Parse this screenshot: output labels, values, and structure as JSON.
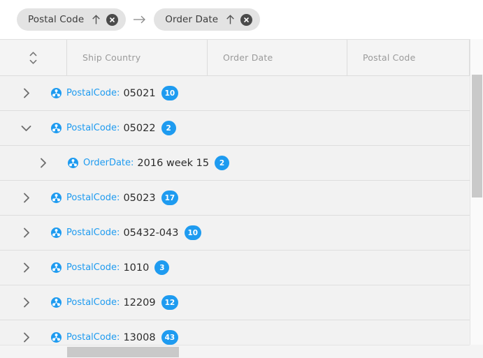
{
  "chip_bar": {
    "chips": [
      {
        "label": "Postal Code",
        "sort_icon": "arrow-up-icon",
        "close_icon": "close-circle-icon"
      },
      {
        "label": "Order Date",
        "sort_icon": "arrow-up-icon",
        "close_icon": "close-circle-icon"
      }
    ],
    "separator_icon": "arrow-right-icon"
  },
  "table": {
    "sort_toggle_icon": "sort-updown-icon",
    "columns": [
      {
        "label": ""
      },
      {
        "label": "Ship Country"
      },
      {
        "label": "Order Date"
      },
      {
        "label": "Postal Code"
      }
    ],
    "rows": [
      {
        "level": 0,
        "expanded": false,
        "twisty_icon": "chevron-right-icon",
        "group_icon": "group-node-icon",
        "field": "PostalCode:",
        "value": "05021",
        "count": "10"
      },
      {
        "level": 0,
        "expanded": true,
        "twisty_icon": "chevron-down-icon",
        "group_icon": "group-node-icon",
        "field": "PostalCode:",
        "value": "05022",
        "count": "2"
      },
      {
        "level": 1,
        "expanded": false,
        "twisty_icon": "chevron-right-icon",
        "group_icon": "group-node-icon",
        "field": "OrderDate:",
        "value": "2016 week 15",
        "count": "2"
      },
      {
        "level": 0,
        "expanded": false,
        "twisty_icon": "chevron-right-icon",
        "group_icon": "group-node-icon",
        "field": "PostalCode:",
        "value": "05023",
        "count": "17"
      },
      {
        "level": 0,
        "expanded": false,
        "twisty_icon": "chevron-right-icon",
        "group_icon": "group-node-icon",
        "field": "PostalCode:",
        "value": "05432-043",
        "count": "10"
      },
      {
        "level": 0,
        "expanded": false,
        "twisty_icon": "chevron-right-icon",
        "group_icon": "group-node-icon",
        "field": "PostalCode:",
        "value": "1010",
        "count": "3"
      },
      {
        "level": 0,
        "expanded": false,
        "twisty_icon": "chevron-right-icon",
        "group_icon": "group-node-icon",
        "field": "PostalCode:",
        "value": "12209",
        "count": "12"
      },
      {
        "level": 0,
        "expanded": false,
        "twisty_icon": "chevron-right-icon",
        "group_icon": "group-node-icon",
        "field": "PostalCode:",
        "value": "13008",
        "count": "43"
      }
    ]
  },
  "colors": {
    "accent_blue": "#1e9bf0",
    "chip_background": "#e3e3e3",
    "row_background": "#f2f2f2",
    "scrollbar_thumb": "#c9c9c9"
  }
}
